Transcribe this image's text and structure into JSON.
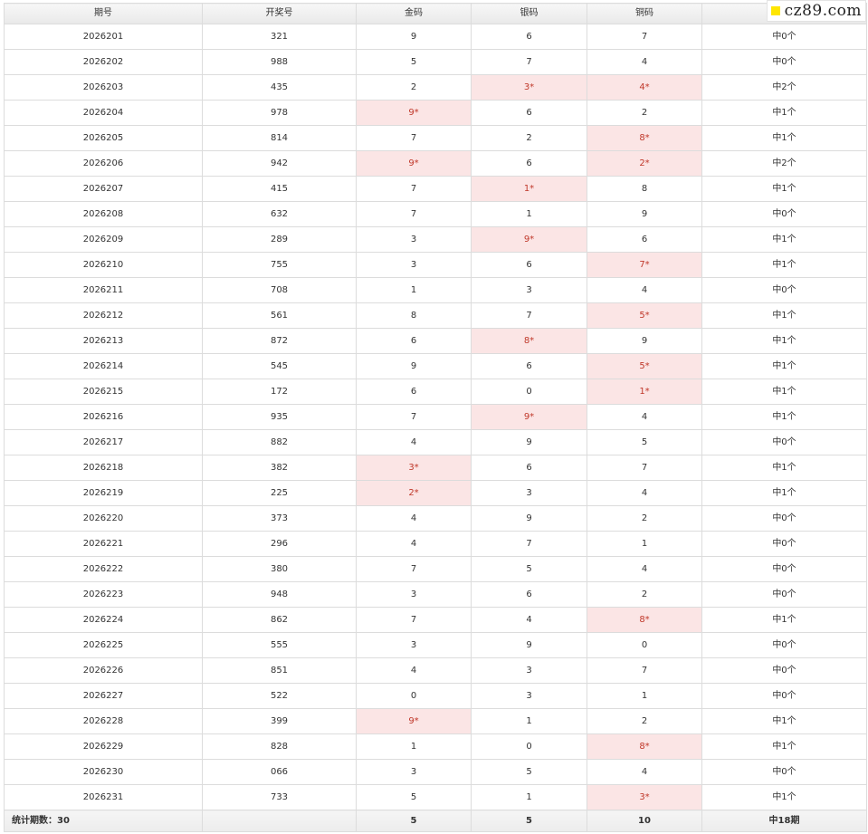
{
  "watermark": {
    "text": "cz89.com",
    "square_color": "#ffe600"
  },
  "colors": {
    "hit_bg": "#fbe5e5",
    "hit_text": "#c0392b"
  },
  "table": {
    "headers": [
      "期号",
      "开奖号",
      "金码",
      "银码",
      "铜码",
      ""
    ],
    "rows": [
      [
        "2026201",
        "321",
        "9",
        "6",
        "7",
        "中0个"
      ],
      [
        "2026202",
        "988",
        "5",
        "7",
        "4",
        "中0个"
      ],
      [
        "2026203",
        "435",
        "2",
        "3*",
        "4*",
        "中2个"
      ],
      [
        "2026204",
        "978",
        "9*",
        "6",
        "2",
        "中1个"
      ],
      [
        "2026205",
        "814",
        "7",
        "2",
        "8*",
        "中1个"
      ],
      [
        "2026206",
        "942",
        "9*",
        "6",
        "2*",
        "中2个"
      ],
      [
        "2026207",
        "415",
        "7",
        "1*",
        "8",
        "中1个"
      ],
      [
        "2026208",
        "632",
        "7",
        "1",
        "9",
        "中0个"
      ],
      [
        "2026209",
        "289",
        "3",
        "9*",
        "6",
        "中1个"
      ],
      [
        "2026210",
        "755",
        "3",
        "6",
        "7*",
        "中1个"
      ],
      [
        "2026211",
        "708",
        "1",
        "3",
        "4",
        "中0个"
      ],
      [
        "2026212",
        "561",
        "8",
        "7",
        "5*",
        "中1个"
      ],
      [
        "2026213",
        "872",
        "6",
        "8*",
        "9",
        "中1个"
      ],
      [
        "2026214",
        "545",
        "9",
        "6",
        "5*",
        "中1个"
      ],
      [
        "2026215",
        "172",
        "6",
        "0",
        "1*",
        "中1个"
      ],
      [
        "2026216",
        "935",
        "7",
        "9*",
        "4",
        "中1个"
      ],
      [
        "2026217",
        "882",
        "4",
        "9",
        "5",
        "中0个"
      ],
      [
        "2026218",
        "382",
        "3*",
        "6",
        "7",
        "中1个"
      ],
      [
        "2026219",
        "225",
        "2*",
        "3",
        "4",
        "中1个"
      ],
      [
        "2026220",
        "373",
        "4",
        "9",
        "2",
        "中0个"
      ],
      [
        "2026221",
        "296",
        "4",
        "7",
        "1",
        "中0个"
      ],
      [
        "2026222",
        "380",
        "7",
        "5",
        "4",
        "中0个"
      ],
      [
        "2026223",
        "948",
        "3",
        "6",
        "2",
        "中0个"
      ],
      [
        "2026224",
        "862",
        "7",
        "4",
        "8*",
        "中1个"
      ],
      [
        "2026225",
        "555",
        "3",
        "9",
        "0",
        "中0个"
      ],
      [
        "2026226",
        "851",
        "4",
        "3",
        "7",
        "中0个"
      ],
      [
        "2026227",
        "522",
        "0",
        "3",
        "1",
        "中0个"
      ],
      [
        "2026228",
        "399",
        "9*",
        "1",
        "2",
        "中1个"
      ],
      [
        "2026229",
        "828",
        "1",
        "0",
        "8*",
        "中1个"
      ],
      [
        "2026230",
        "066",
        "3",
        "5",
        "4",
        "中0个"
      ],
      [
        "2026231",
        "733",
        "5",
        "1",
        "3*",
        "中1个"
      ]
    ],
    "footer": {
      "label": "统计期数：30",
      "col2": "",
      "gold": "5",
      "silver": "5",
      "bronze": "10",
      "total": "中18期"
    }
  }
}
